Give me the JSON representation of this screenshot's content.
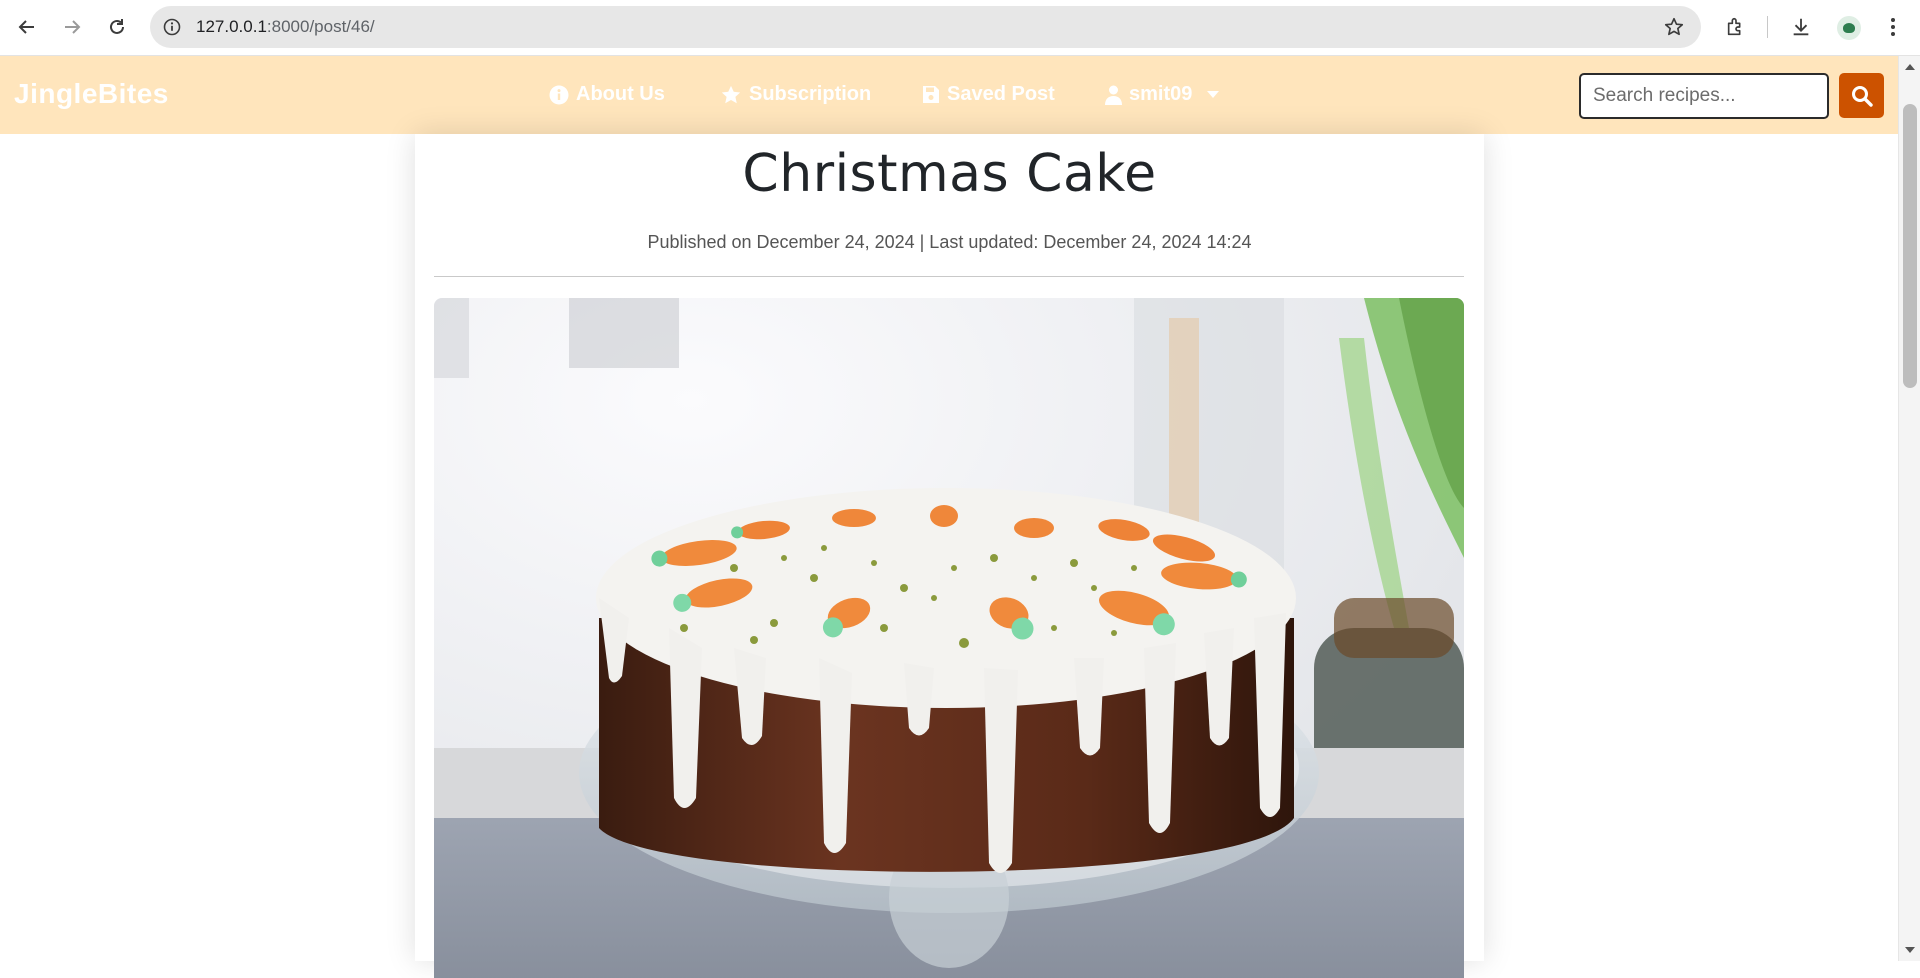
{
  "browser": {
    "url_host": "127.0.0.1",
    "url_path": ":8000/post/46/",
    "icons": [
      "back-arrow-icon",
      "forward-arrow-icon",
      "reload-icon",
      "site-info-icon",
      "bookmark-star-icon",
      "extensions-icon",
      "download-icon",
      "profile-avatar-icon",
      "more-menu-icon"
    ]
  },
  "navbar": {
    "brand": "JingleBites",
    "items": [
      {
        "label": "About Us",
        "icon": "info-circle-icon"
      },
      {
        "label": "Subscription",
        "icon": "star-icon"
      },
      {
        "label": "Saved Post",
        "icon": "save-disk-icon"
      },
      {
        "label": "smit09",
        "icon": "user-icon"
      }
    ],
    "search_placeholder": "Search recipes...",
    "search_icon": "search-icon",
    "colors": {
      "background": "#ffe5bc",
      "search_button": "#cc5200",
      "text": "#ffffff"
    }
  },
  "post": {
    "title": "Christmas Cake",
    "meta": "Published on December 24, 2024 | Last updated: December 24, 2024 14:24",
    "image_alt": "Christmas cake with white icing and marzipan carrots on a glass cake stand"
  }
}
